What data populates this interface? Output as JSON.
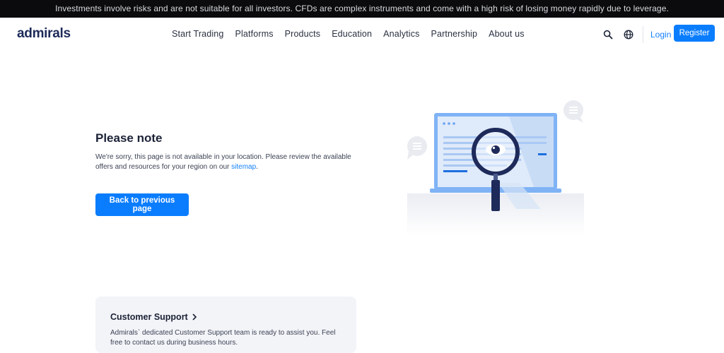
{
  "risk_banner": {
    "text": "Investments involve risks and are not suitable for all investors. CFDs are complex instruments and come with a high risk of losing money rapidly due to leverage."
  },
  "header": {
    "logo": "admirals",
    "nav": [
      {
        "label": "Start Trading"
      },
      {
        "label": "Platforms"
      },
      {
        "label": "Products"
      },
      {
        "label": "Education"
      },
      {
        "label": "Analytics"
      },
      {
        "label": "Partnership"
      },
      {
        "label": "About us"
      }
    ],
    "icons": {
      "search": "search-icon",
      "language": "globe-icon"
    },
    "login_label": "Login",
    "register_label": "Register"
  },
  "notice": {
    "title": "Please note",
    "text_before_link": "We're sorry, this page is not available in your location. Please review the available offers and resources for your region on our ",
    "link_label": "sitemap",
    "text_after_link": ".",
    "back_button": "Back to previous page"
  },
  "support": {
    "title": "Customer Support",
    "text": "Admirals` dedicated Customer Support team is ready to assist you. Feel free to contact us during business hours."
  },
  "colors": {
    "accent": "#0a7dff",
    "link": "#1581ff",
    "banner_bg": "#0b0b0d",
    "logo": "#1d2a58",
    "card_bg": "#f3f4f8"
  }
}
